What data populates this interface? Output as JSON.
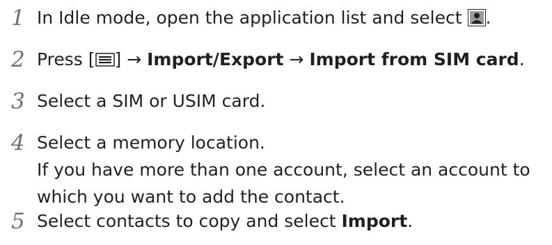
{
  "steps": [
    {
      "number": "1",
      "text_before": "In Idle mode, open the application list and select ",
      "icon": "contacts-icon",
      "text_after": "."
    },
    {
      "number": "2",
      "press": "Press [",
      "icon": "menu-icon",
      "close_bracket": "] ",
      "arrow": "→",
      "bold_1": "Import/Export",
      "bold_2": "Import from SIM card",
      "end": "."
    },
    {
      "number": "3",
      "text": "Select a SIM or USIM card."
    },
    {
      "number": "4",
      "line_1": "Select a memory location.",
      "line_2": "If you have more than one account, select an account to which you want to add the contact."
    },
    {
      "number": "5",
      "text_before": "Select contacts to copy and select ",
      "bold": "Import",
      "text_after": "."
    }
  ]
}
